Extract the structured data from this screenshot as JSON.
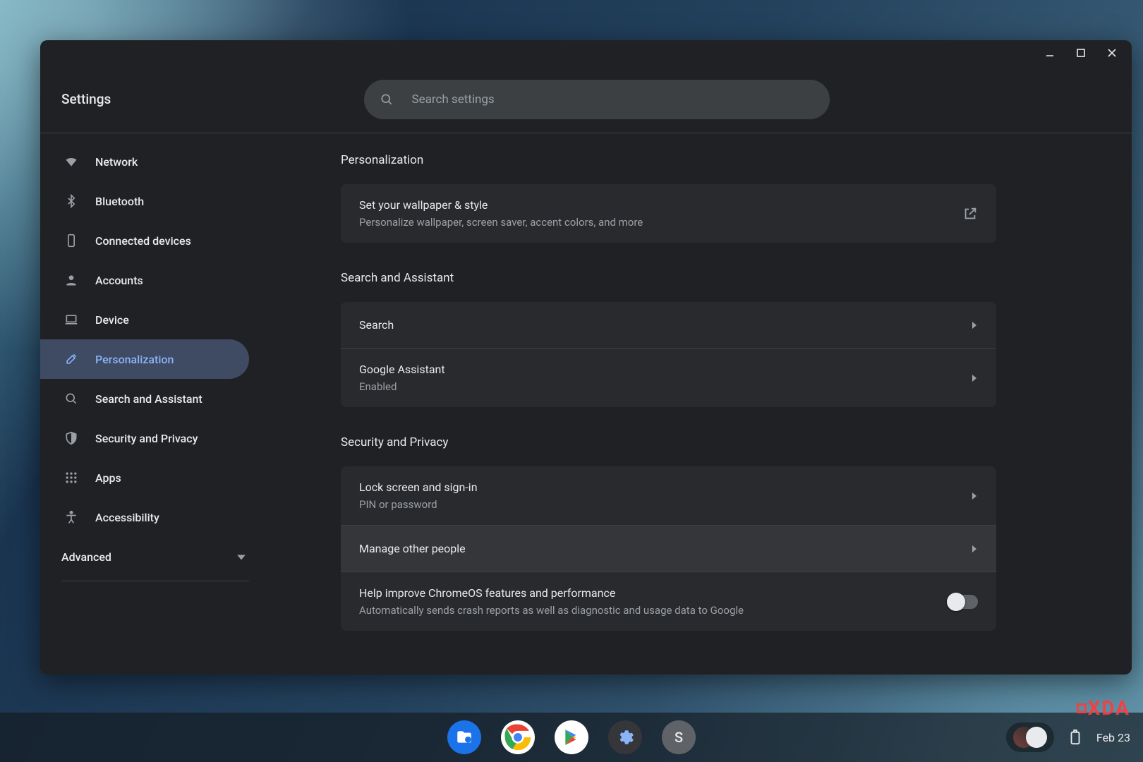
{
  "app": {
    "title": "Settings"
  },
  "search": {
    "placeholder": "Search settings"
  },
  "sidebar": {
    "items": [
      {
        "label": "Network"
      },
      {
        "label": "Bluetooth"
      },
      {
        "label": "Connected devices"
      },
      {
        "label": "Accounts"
      },
      {
        "label": "Device"
      },
      {
        "label": "Personalization"
      },
      {
        "label": "Search and Assistant"
      },
      {
        "label": "Security and Privacy"
      },
      {
        "label": "Apps"
      },
      {
        "label": "Accessibility"
      }
    ],
    "advanced": "Advanced"
  },
  "sections": {
    "personalization": {
      "title": "Personalization",
      "wallpaper_title": "Set your wallpaper & style",
      "wallpaper_sub": "Personalize wallpaper, screen saver, accent colors, and more"
    },
    "search_assistant": {
      "title": "Search and Assistant",
      "search_row": "Search",
      "assistant_title": "Google Assistant",
      "assistant_status": "Enabled"
    },
    "security": {
      "title": "Security and Privacy",
      "lock_title": "Lock screen and sign-in",
      "lock_sub": "PIN or password",
      "manage_people": "Manage other people",
      "improve_title": "Help improve ChromeOS features and performance",
      "improve_sub": "Automatically sends crash reports as well as diagnostic and usage data to Google"
    }
  },
  "shelf": {
    "date": "Feb 23",
    "avatar_letter": "S"
  },
  "watermark": "XDA"
}
